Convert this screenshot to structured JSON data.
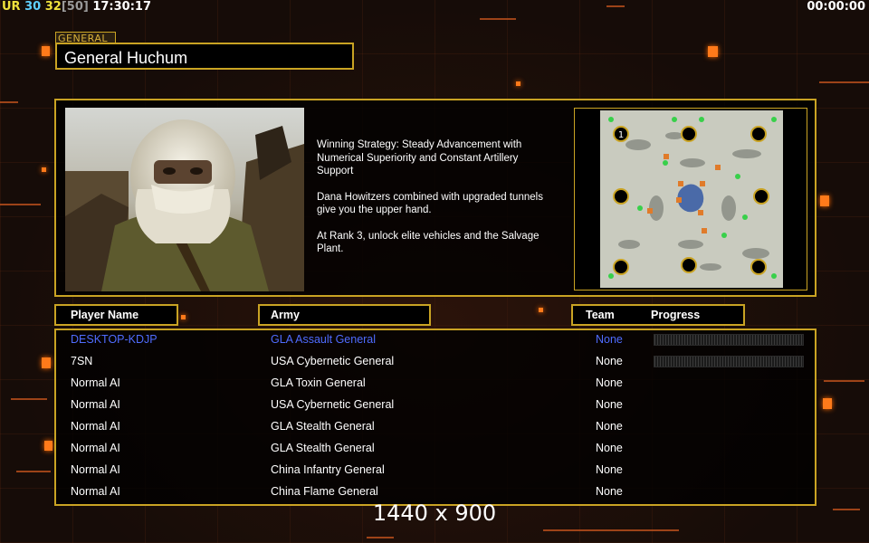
{
  "hud": {
    "ur": "UR",
    "n1": "30",
    "n2": "32",
    "bracket": "[50]",
    "clock": "17:30:17",
    "timer": "00:00:00"
  },
  "general": {
    "label": "GENERAL",
    "name": "General Huchum"
  },
  "strategy": {
    "p1": "Winning Strategy: Steady Advancement with\n Numerical Superiority and Constant Artillery\n Support",
    "p2": "Dana Howitzers combined with upgraded tunnels\n give you the upper hand.",
    "p3": "At Rank 3, unlock elite vehicles and the Salvage\n Plant."
  },
  "minimap": {
    "start_marker": "1"
  },
  "columns": {
    "player": "Player Name",
    "army": "Army",
    "team": "Team",
    "progress": "Progress"
  },
  "players": [
    {
      "name": "DESKTOP-KDJP",
      "army": "GLA Assault General",
      "team": "None"
    },
    {
      "name": "7SN",
      "army": "USA Cybernetic General",
      "team": "None"
    },
    {
      "name": "Normal AI",
      "army": "GLA Toxin General",
      "team": "None"
    },
    {
      "name": "Normal AI",
      "army": "USA Cybernetic General",
      "team": "None"
    },
    {
      "name": "Normal AI",
      "army": "GLA Stealth General",
      "team": "None"
    },
    {
      "name": "Normal AI",
      "army": "GLA Stealth General",
      "team": "None"
    },
    {
      "name": "Normal AI",
      "army": "China Infantry General",
      "team": "None"
    },
    {
      "name": "Normal AI",
      "army": "China Flame General",
      "team": "None"
    }
  ],
  "resolution": "1440 x 900",
  "colors": {
    "border": "#c9a323",
    "human_player": "#4f6cff",
    "accent": "#ff7a1a"
  }
}
